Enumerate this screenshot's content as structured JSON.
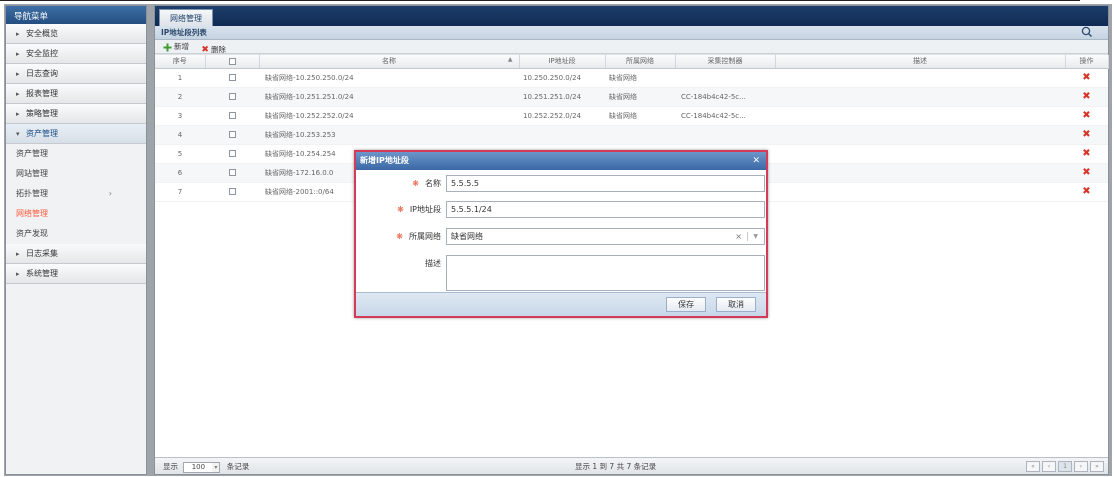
{
  "sidebar": {
    "title": "导航菜单",
    "items": [
      {
        "label": "安全概览"
      },
      {
        "label": "安全监控"
      },
      {
        "label": "日志查询"
      },
      {
        "label": "报表管理"
      },
      {
        "label": "策略管理"
      },
      {
        "label": "资产管理"
      }
    ],
    "sub_items": [
      {
        "label": "资产管理"
      },
      {
        "label": "网站管理"
      },
      {
        "label": "拓扑管理"
      },
      {
        "label": "网络管理"
      },
      {
        "label": "资产发现"
      }
    ],
    "items_after": [
      {
        "label": "日志采集"
      },
      {
        "label": "系统管理"
      }
    ]
  },
  "tab": {
    "label": "网络管理"
  },
  "panel": {
    "title": "IP地址段列表"
  },
  "toolbar": {
    "add_label": "新增",
    "delete_label": "删除"
  },
  "table": {
    "headers": {
      "seq": "序号",
      "name": "名称",
      "ip": "IP地址段",
      "network": "所属网络",
      "collector": "采集控制器",
      "desc": "描述",
      "op": "操作"
    },
    "rows": [
      {
        "seq": "1",
        "name": "缺省网络-10.250.250.0/24",
        "ip": "10.250.250.0/24",
        "network": "缺省网络",
        "collector": ""
      },
      {
        "seq": "2",
        "name": "缺省网络-10.251.251.0/24",
        "ip": "10.251.251.0/24",
        "network": "缺省网络",
        "collector": "CC-184b4c42-5c..."
      },
      {
        "seq": "3",
        "name": "缺省网络-10.252.252.0/24",
        "ip": "10.252.252.0/24",
        "network": "缺省网络",
        "collector": "CC-184b4c42-5c..."
      },
      {
        "seq": "4",
        "name": "缺省网络-10.253.253",
        "ip": "",
        "network": "",
        "collector": ""
      },
      {
        "seq": "5",
        "name": "缺省网络-10.254.254",
        "ip": "",
        "network": "",
        "collector": ""
      },
      {
        "seq": "6",
        "name": "缺省网络-172.16.0.0",
        "ip": "",
        "network": "",
        "collector": ""
      },
      {
        "seq": "7",
        "name": "缺省网络-2001::0/64",
        "ip": "",
        "network": "",
        "collector": ""
      }
    ]
  },
  "footer": {
    "show_label": "显示",
    "page_size": "100",
    "records_label": "条记录",
    "info": "显示 1 到 7 共 7 条记录"
  },
  "modal": {
    "title": "新增IP地址段",
    "name_label": "名称",
    "name_value": "5.5.5.5",
    "ip_label": "IP地址段",
    "ip_value": "5.5.5.1/24",
    "network_label": "所属网络",
    "network_value": "缺省网络",
    "desc_label": "描述",
    "save_label": "保存",
    "cancel_label": "取消"
  },
  "colors": {
    "accent": "#244e80",
    "required": "#e25a3c",
    "modal_border": "#d63a59",
    "delete": "#d8352a"
  }
}
